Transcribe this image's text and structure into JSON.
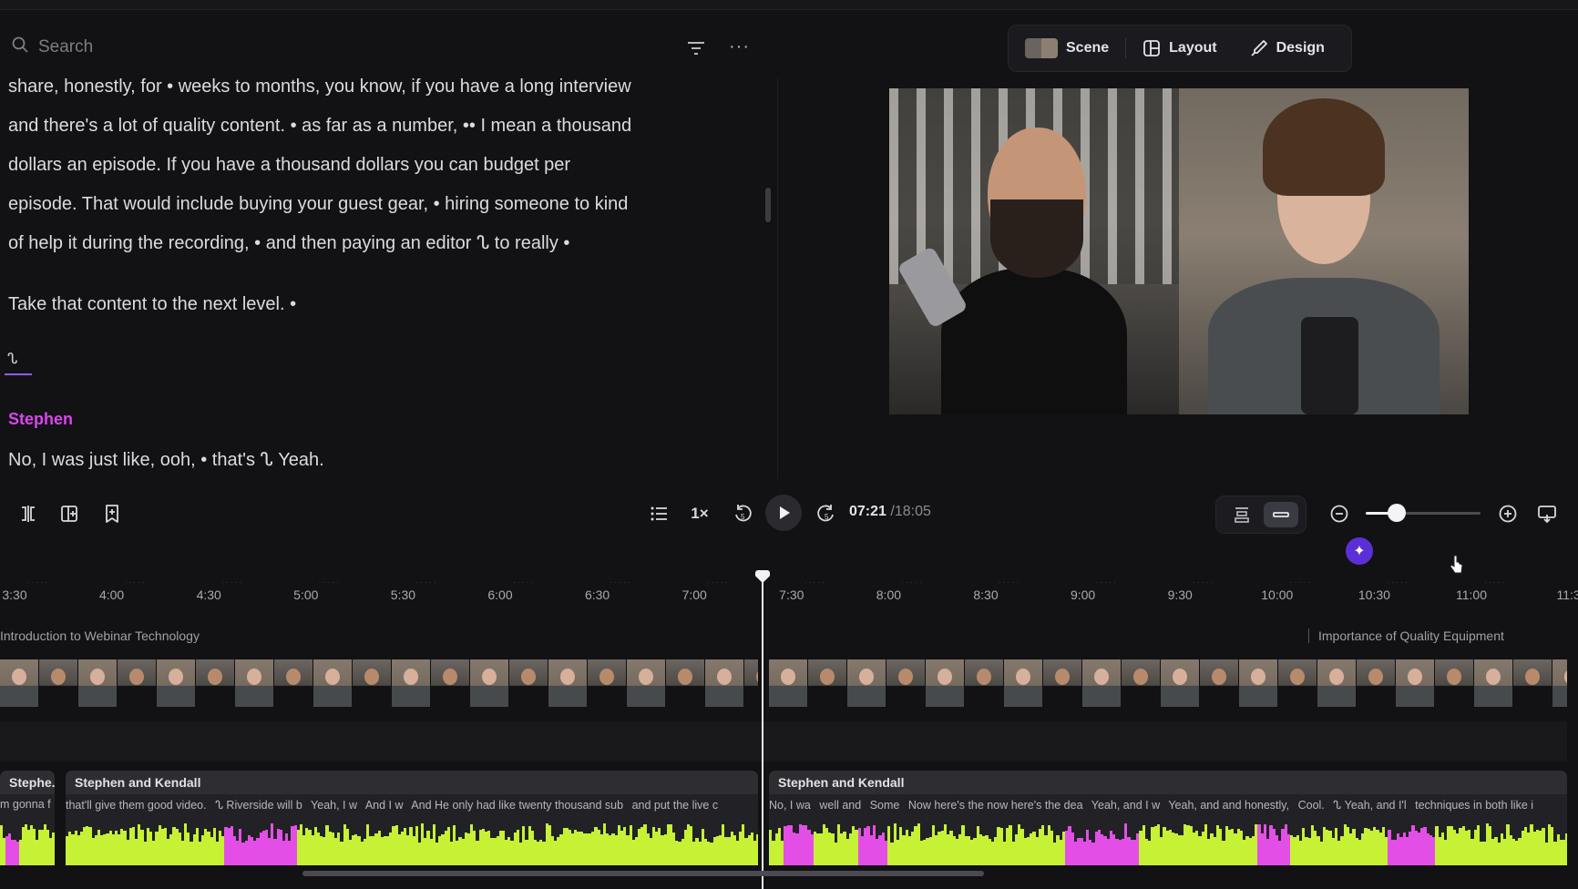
{
  "search": {
    "placeholder": "Search",
    "icon": "search-icon"
  },
  "transcript": {
    "lines": [
      "share, honestly, for • weeks to months, you know, if you have a long interview",
      "and there's a lot of quality content. • as far as a number, •• I mean a thousand",
      "dollars an episode. If you have a thousand dollars you can budget per",
      "episode. That would include buying your guest gear, • hiring someone to kind",
      "of help it during the recording, • and then paying an editor ᔐ to really •"
    ],
    "line_after": "Take that content to the next level. •",
    "wave_glyph": "ᔐ",
    "speaker": "Stephen",
    "speaker_line": "No, I was just like, ooh, • that's ᔐ Yeah."
  },
  "toolbar": {
    "scene": "Scene",
    "layout": "Layout",
    "design": "Design"
  },
  "playback": {
    "speed": "1×",
    "current_time": "07:21",
    "total_time": "/18:05",
    "zoom_level": 0.27
  },
  "timeline": {
    "ticks": [
      "3:30",
      "4:00",
      "4:30",
      "5:00",
      "5:30",
      "6:00",
      "6:30",
      "7:00",
      "7:30",
      "8:00",
      "8:30",
      "9:00",
      "9:30",
      "10:00",
      "10:30",
      "11:00",
      "11:3"
    ],
    "chapters": [
      "Introduction to Webinar Technology",
      "Importance of Quality Equipment"
    ],
    "clips": [
      {
        "title": "Stephe...",
        "snippets": [
          "m gonna f"
        ]
      },
      {
        "title": "Stephen and Kendall",
        "snippets": [
          "that'll give them good video.",
          "ᔐ Riverside will b",
          "Yeah, I w",
          "And I w",
          "And He only had like twenty thousand sub",
          "and put the live c"
        ]
      },
      {
        "title": "Stephen and Kendall",
        "snippets": [
          "No, I wa",
          "well and",
          "Some",
          "Now here's the now here's the dea",
          "Yeah, and I w",
          "Yeah, and and honestly,",
          "Cool.",
          "ᔐ Yeah, and I'l",
          "techniques in both like i"
        ]
      }
    ]
  },
  "colors": {
    "accent": "#8b5cf6",
    "speaker": "#d946ef",
    "wave_green": "#c6f135",
    "wave_pink": "#e34fe6",
    "magic": "#5b2fd6"
  }
}
